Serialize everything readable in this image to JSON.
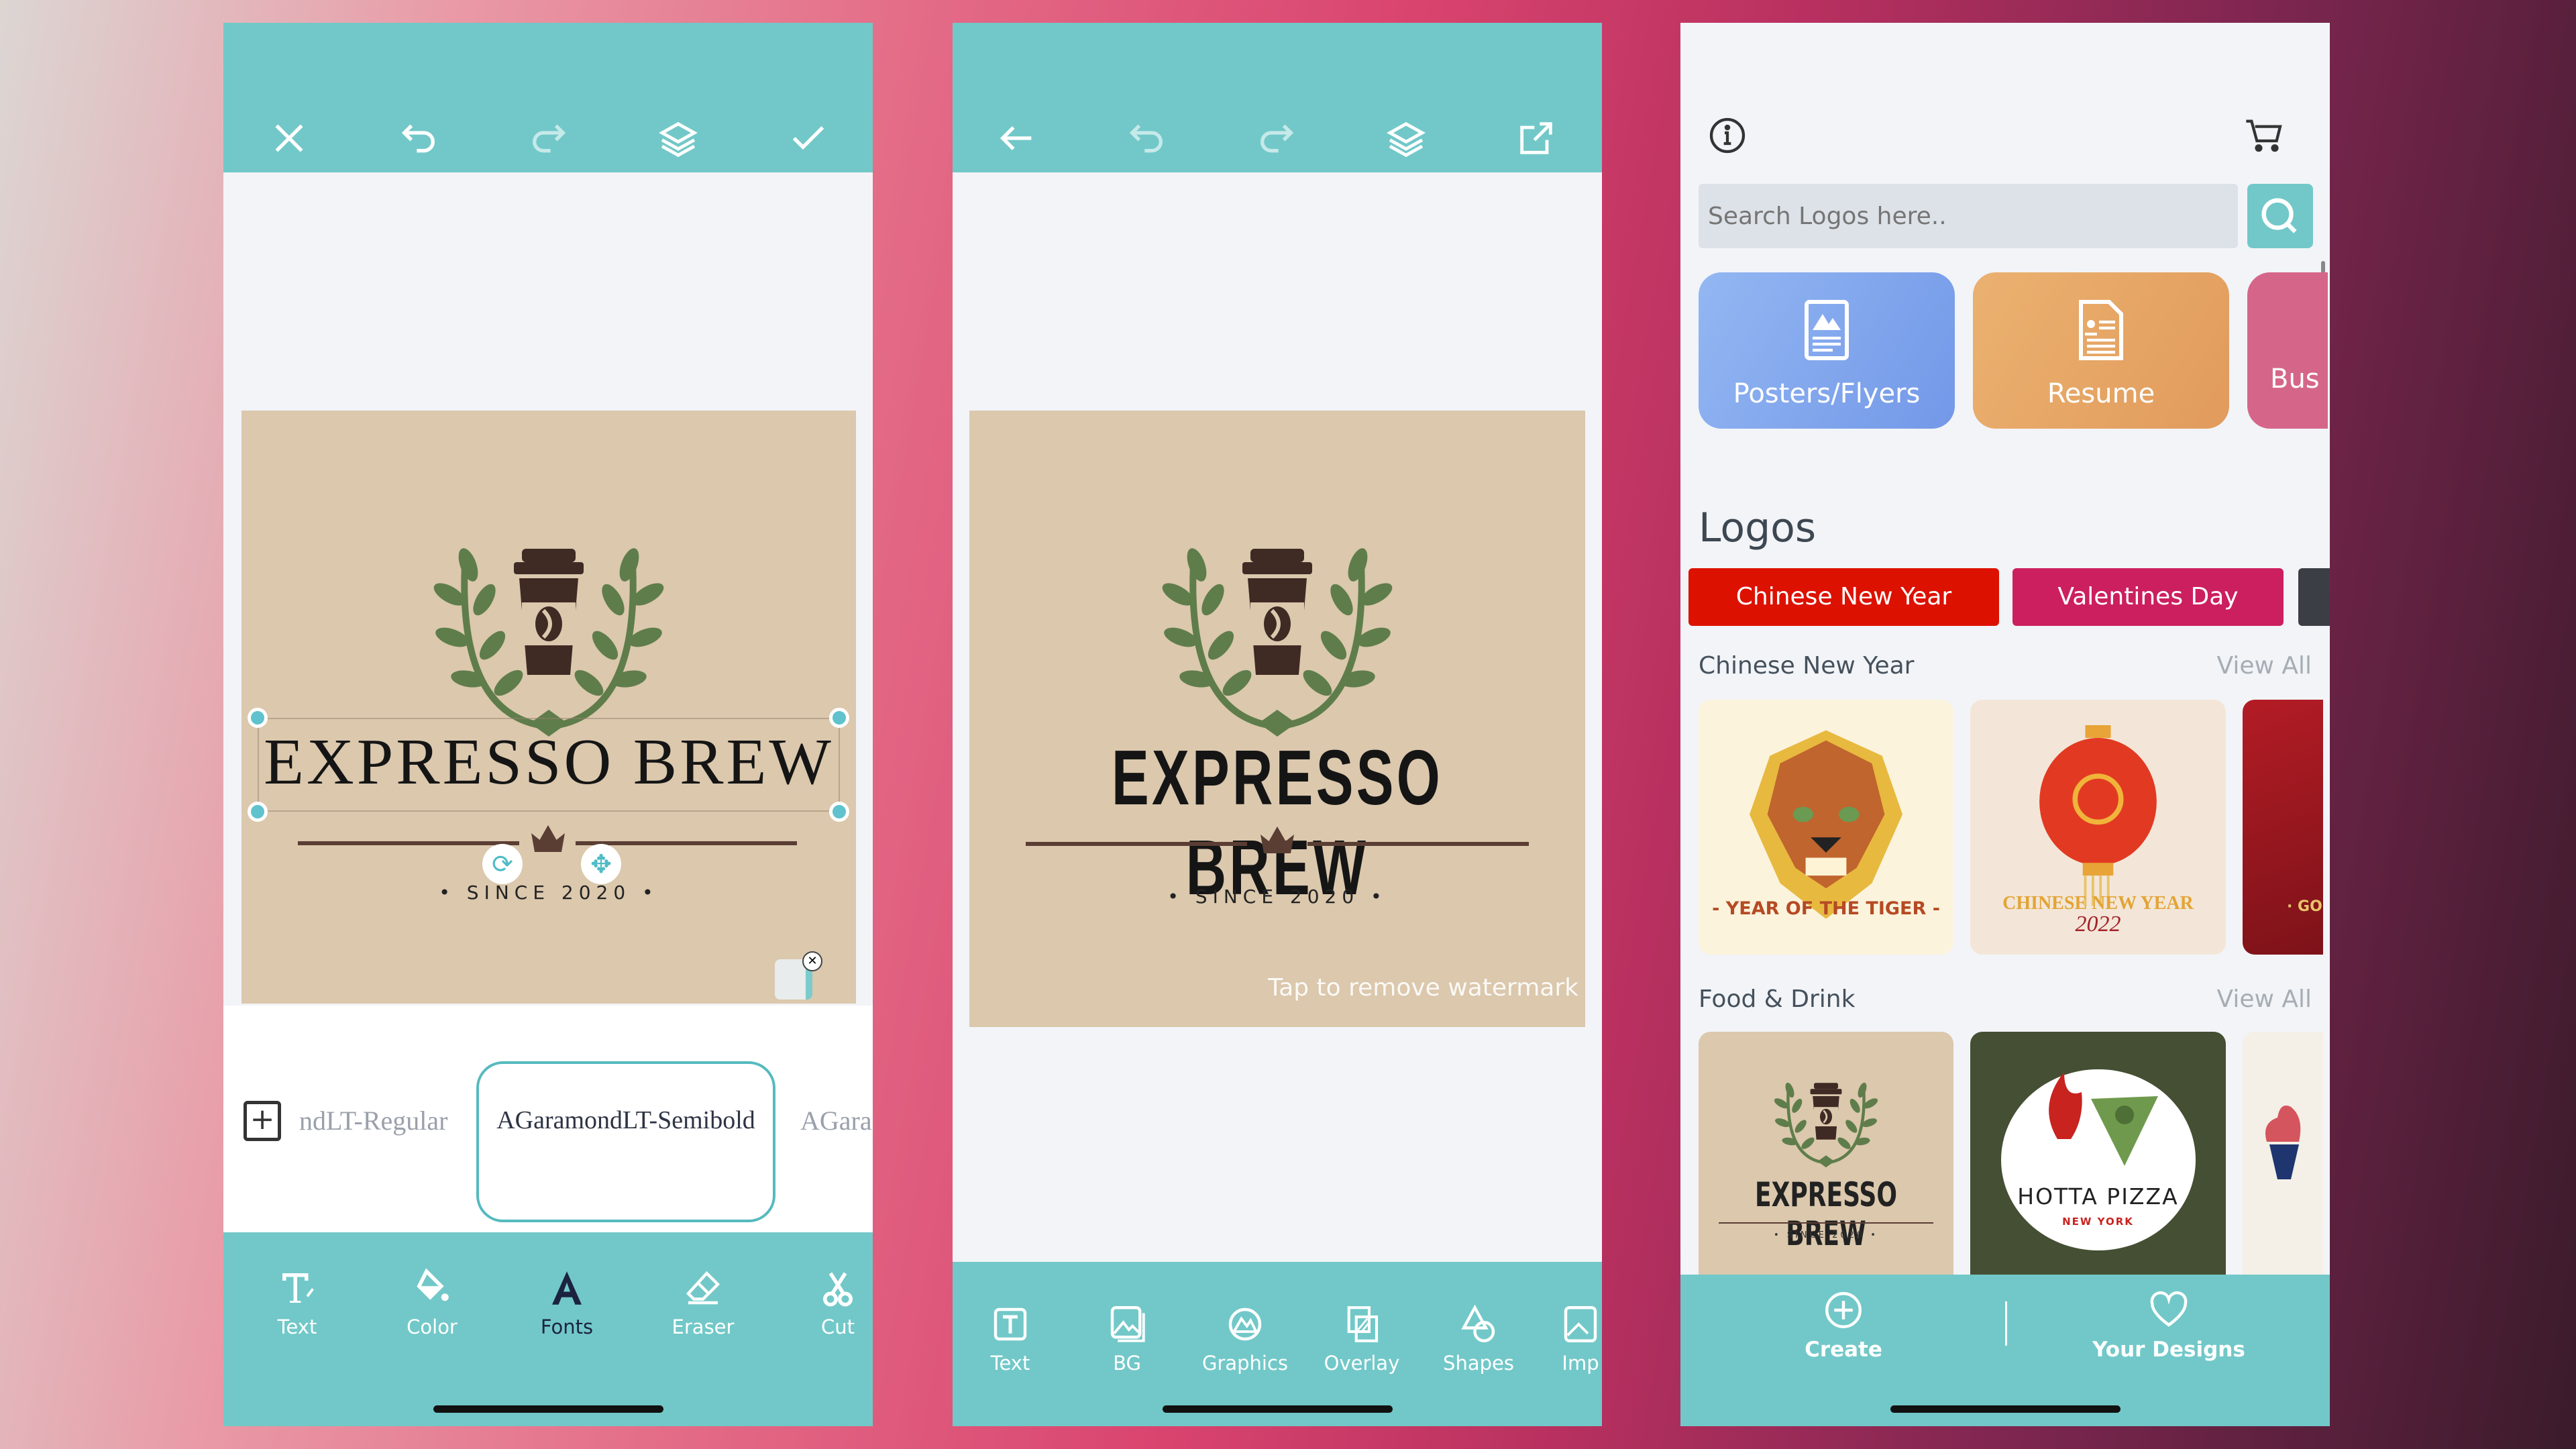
{
  "colors": {
    "teal": "#72c8c8",
    "canvas": "#dbc8ad",
    "chip_red": "#dd1100",
    "chip_pink": "#cc1f5f",
    "dark_text": "#1b2340"
  },
  "editor1": {
    "header_icons": [
      "close-icon",
      "undo-icon",
      "redo-icon",
      "layers-icon",
      "check-icon"
    ],
    "logo": {
      "title": "EXPRESSO BREW",
      "subtitle": "• SINCE 2020 •"
    },
    "fonts": {
      "prev": "ndLT-Regular",
      "selected": "AGaramondLT-Semibold",
      "next": "AGara"
    },
    "toolbar": [
      {
        "label": "Text",
        "icon": "text-edit-icon"
      },
      {
        "label": "Color",
        "icon": "paint-bucket-icon"
      },
      {
        "label": "Fonts",
        "icon": "font-icon",
        "active": true
      },
      {
        "label": "Eraser",
        "icon": "eraser-icon"
      },
      {
        "label": "Cut",
        "icon": "scissors-icon"
      }
    ]
  },
  "editor2": {
    "header_icons": [
      "back-arrow-icon",
      "undo-icon",
      "redo-icon",
      "layers-icon",
      "share-icon"
    ],
    "logo": {
      "title": "EXPRESSO BREW",
      "subtitle": "• SINCE 2020 •"
    },
    "watermark": "Tap to remove watermark",
    "toolbar": [
      {
        "label": "Text",
        "icon": "text-box-icon"
      },
      {
        "label": "BG",
        "icon": "image-icon"
      },
      {
        "label": "Graphics",
        "icon": "graphics-icon"
      },
      {
        "label": "Overlay",
        "icon": "overlay-icon"
      },
      {
        "label": "Shapes",
        "icon": "shapes-icon"
      },
      {
        "label": "Imp",
        "icon": "import-image-icon"
      }
    ]
  },
  "home": {
    "search": {
      "placeholder": "Search Logos here.."
    },
    "categories": [
      {
        "label": "Posters/Flyers",
        "color": "#7fa6ec"
      },
      {
        "label": "Resume",
        "color": "#e8a765"
      },
      {
        "label": "Bus",
        "color": "#d5668a"
      }
    ],
    "section_title": "Logos",
    "chips": [
      "Chinese New Year",
      "Valentines Day"
    ],
    "sections": [
      {
        "title": "Chinese New Year",
        "view_all": "View All",
        "items": [
          {
            "text": "- YEAR OF THE TIGER -"
          },
          {
            "text": "CHINESE NEW YEAR",
            "sub": "2022"
          },
          {
            "text": "· GO"
          }
        ]
      },
      {
        "title": "Food & Drink",
        "view_all": "View All",
        "items": [
          {
            "text": "EXPRESSO BREW",
            "sub": "• SINCE 2020 •"
          },
          {
            "text": "HOTTA PIZZA",
            "sub": "NEW YORK"
          },
          {
            "text": ""
          }
        ]
      }
    ],
    "nav": [
      {
        "label": "Create",
        "icon": "plus-circle-icon"
      },
      {
        "label": "Your Designs",
        "icon": "heart-icon"
      }
    ]
  }
}
